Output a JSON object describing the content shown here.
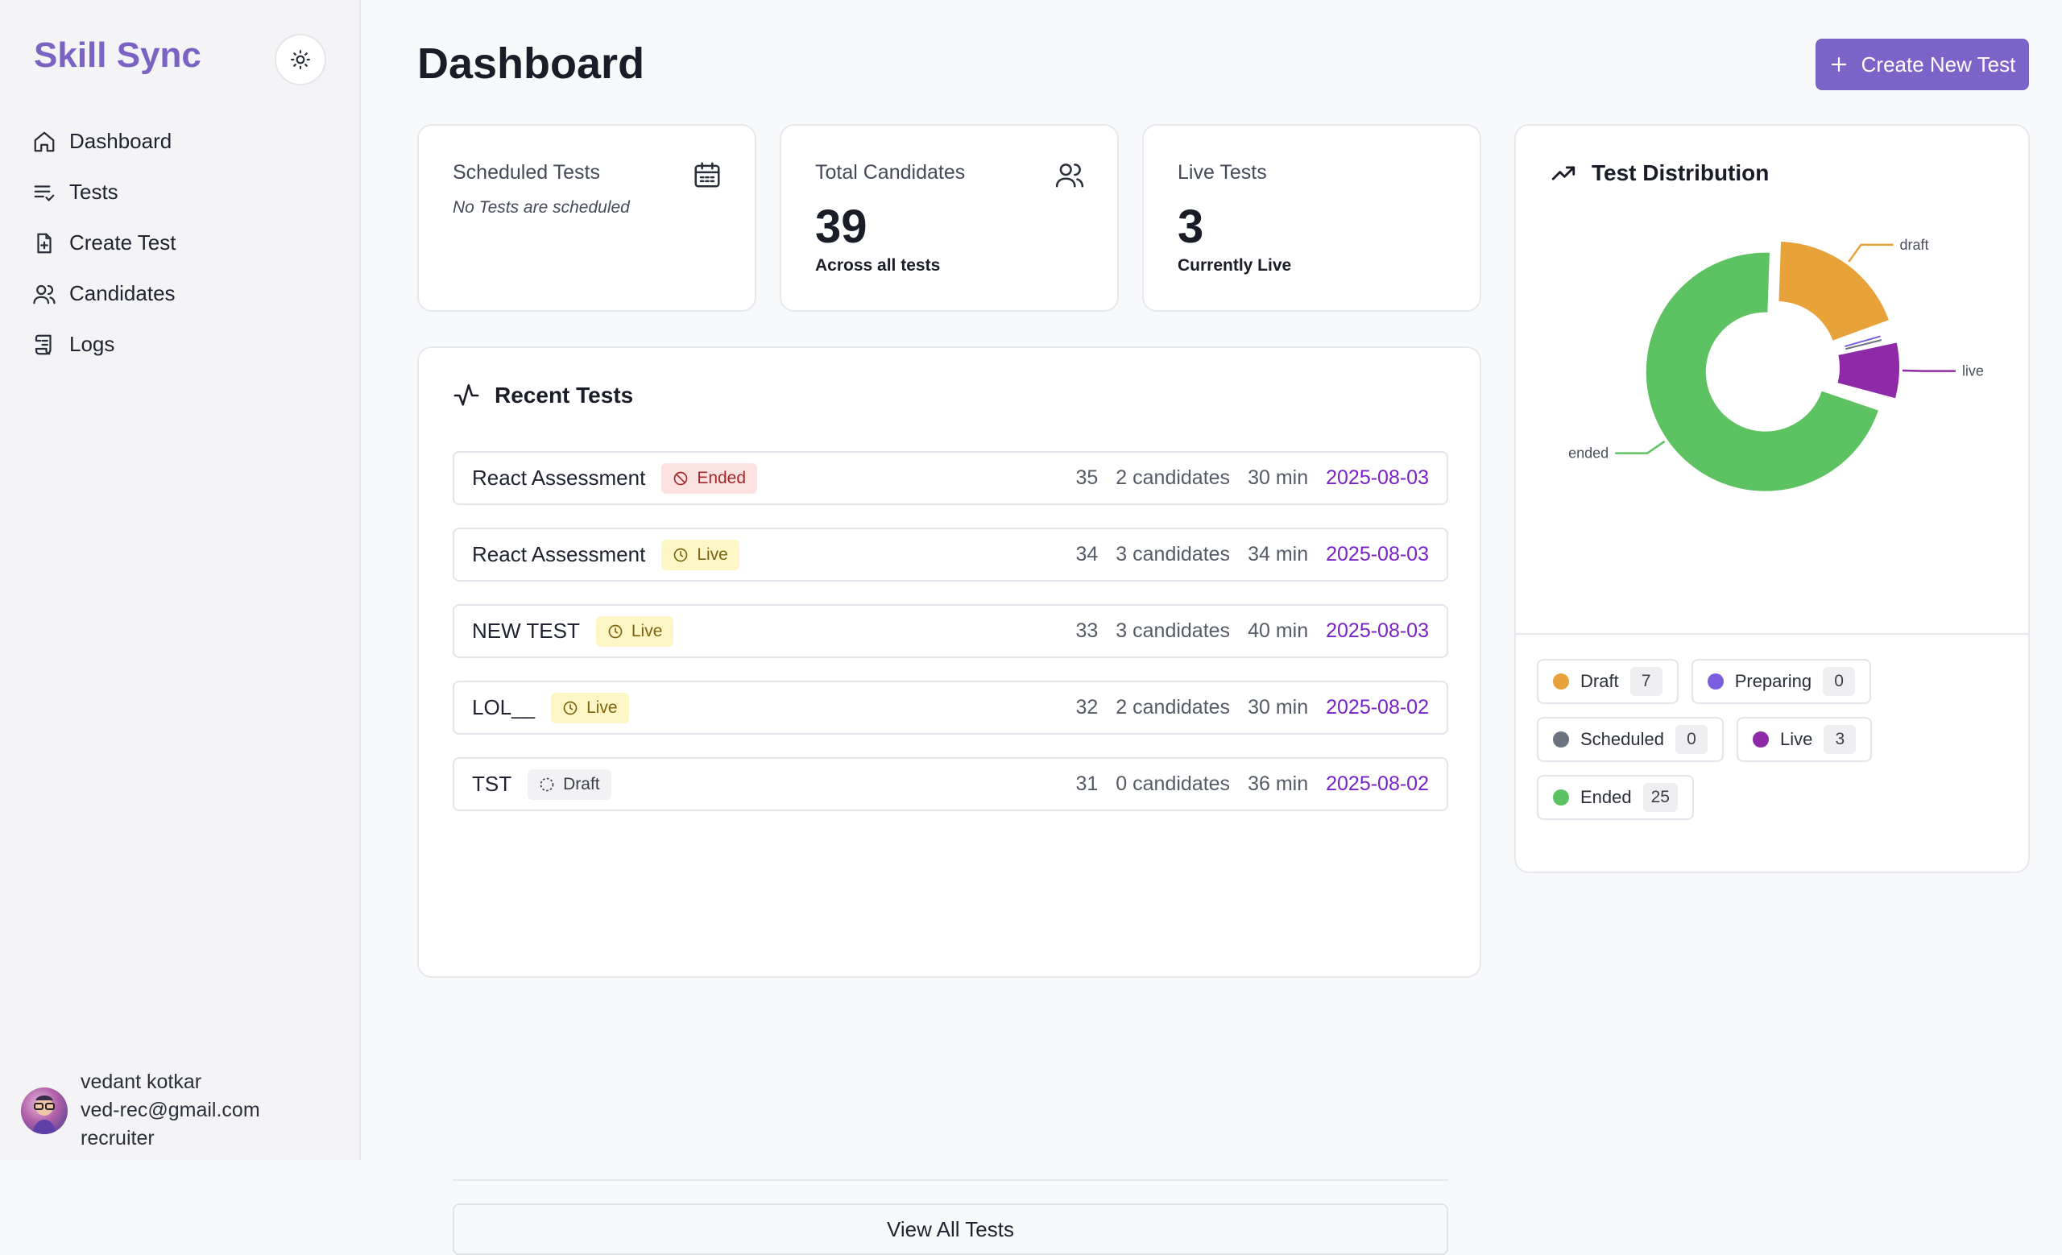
{
  "brand": "Skill Sync",
  "nav": [
    {
      "label": "Dashboard",
      "icon": "home-icon"
    },
    {
      "label": "Tests",
      "icon": "list-check-icon"
    },
    {
      "label": "Create Test",
      "icon": "file-plus-icon"
    },
    {
      "label": "Candidates",
      "icon": "users-icon"
    },
    {
      "label": "Logs",
      "icon": "scroll-icon"
    }
  ],
  "user": {
    "name": "vedant kotkar",
    "email": "ved-rec@gmail.com",
    "role": "recruiter"
  },
  "header": {
    "title": "Dashboard",
    "create_button": "Create New Test"
  },
  "stats": {
    "scheduled": {
      "label": "Scheduled Tests",
      "note": "No Tests are scheduled"
    },
    "candidates": {
      "label": "Total Candidates",
      "value": "39",
      "sub": "Across all tests"
    },
    "live": {
      "label": "Live Tests",
      "value": "3",
      "sub": "Currently Live"
    }
  },
  "recent": {
    "title": "Recent Tests",
    "rows": [
      {
        "name": "React Assessment",
        "status": "Ended",
        "id": "35",
        "candidates": "2 candidates",
        "duration": "30 min",
        "date": "2025-08-03"
      },
      {
        "name": "React Assessment",
        "status": "Live",
        "id": "34",
        "candidates": "3 candidates",
        "duration": "34 min",
        "date": "2025-08-03"
      },
      {
        "name": "NEW TEST",
        "status": "Live",
        "id": "33",
        "candidates": "3 candidates",
        "duration": "40 min",
        "date": "2025-08-03"
      },
      {
        "name": "LOL__",
        "status": "Live",
        "id": "32",
        "candidates": "2 candidates",
        "duration": "30 min",
        "date": "2025-08-02"
      },
      {
        "name": "TST",
        "status": "Draft",
        "id": "31",
        "candidates": "0 candidates",
        "duration": "36 min",
        "date": "2025-08-02"
      }
    ],
    "view_all": "View All Tests"
  },
  "distribution": {
    "title": "Test Distribution",
    "legend": [
      {
        "label": "Draft",
        "count": "7",
        "color": "#e8a23a"
      },
      {
        "label": "Preparing",
        "count": "0",
        "color": "#7b5de0"
      },
      {
        "label": "Scheduled",
        "count": "0",
        "color": "#6b7280"
      },
      {
        "label": "Live",
        "count": "3",
        "color": "#8e2aa8"
      },
      {
        "label": "Ended",
        "count": "25",
        "color": "#5dc262"
      }
    ]
  },
  "chart_data": {
    "type": "pie",
    "donut": true,
    "categories": [
      "draft",
      "preparing",
      "scheduled",
      "live",
      "ended"
    ],
    "values": [
      7,
      0,
      0,
      3,
      25
    ],
    "colors": [
      "#e8a23a",
      "#7b5de0",
      "#6b7280",
      "#8e2aa8",
      "#5dc262"
    ],
    "labels_shown": [
      "draft",
      "live",
      "ended"
    ]
  }
}
